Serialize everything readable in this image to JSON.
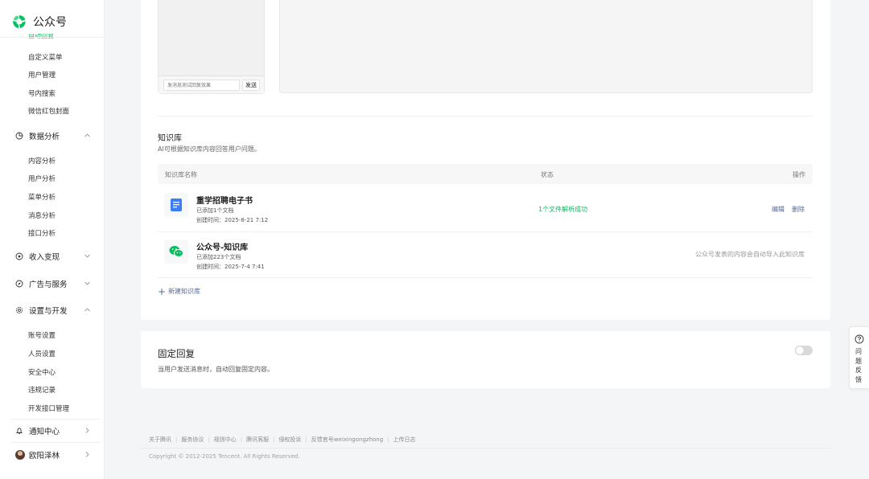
{
  "brand": {
    "name": "公众号"
  },
  "sidebar": {
    "cut_item": "自动回复",
    "group1_items": [
      {
        "label": "自定义菜单"
      },
      {
        "label": "用户管理"
      },
      {
        "label": "号内搜索"
      },
      {
        "label": "微信红包封面"
      }
    ],
    "data_analysis": {
      "label": "数据分析",
      "items": [
        {
          "label": "内容分析"
        },
        {
          "label": "用户分析"
        },
        {
          "label": "菜单分析"
        },
        {
          "label": "消息分析"
        },
        {
          "label": "接口分析"
        }
      ]
    },
    "monetize": {
      "label": "收入变现"
    },
    "ads": {
      "label": "广告与服务"
    },
    "settings": {
      "label": "设置与开发",
      "items": [
        {
          "label": "账号设置"
        },
        {
          "label": "人员设置"
        },
        {
          "label": "安全中心"
        },
        {
          "label": "违规记录"
        },
        {
          "label": "开发接口管理"
        }
      ]
    },
    "notifications": {
      "label": "通知中心"
    },
    "user": {
      "name": "欧阳泽林"
    }
  },
  "preview": {
    "input_placeholder": "发消息测试回复效果",
    "send_label": "发送"
  },
  "knowledge": {
    "title": "知识库",
    "description": "AI可根据知识库内容回答用户问题。",
    "columns": {
      "name": "知识库名称",
      "status": "状态",
      "action": "操作"
    },
    "rows": [
      {
        "name": "重学招聘电子书",
        "docs": "已添加1个文档",
        "created": "创建时间：2025-8-21 7:12",
        "status": "1个文件解析成功",
        "edit": "编辑",
        "delete": "删除",
        "icon": "document-icon"
      },
      {
        "name": "公众号-知识库",
        "docs": "已添加223个文档",
        "created": "创建时间：2025-7-4 7:41",
        "note": "公众号发表的内容会自动导入此知识库",
        "icon": "wechat-icon"
      }
    ],
    "new_label": "新建知识库"
  },
  "fixed_reply": {
    "title": "固定回复",
    "description": "当用户发送消息时，自动回复固定内容。",
    "enabled": false
  },
  "feedback": {
    "label": "问题反馈"
  },
  "footer": {
    "links": [
      {
        "label": "关于腾讯"
      },
      {
        "label": "服务协议"
      },
      {
        "label": "规则中心"
      },
      {
        "label": "腾讯客服"
      },
      {
        "label": "侵权投诉"
      },
      {
        "label": "反馈官号weixingongzhong"
      },
      {
        "label": "上传日志"
      }
    ],
    "copyright": "Copyright © 2012-2025 Tencent. All Rights Reserved."
  },
  "colors": {
    "accent": "#07c160",
    "link": "#576b95",
    "page_bg": "#f4f5f7"
  }
}
